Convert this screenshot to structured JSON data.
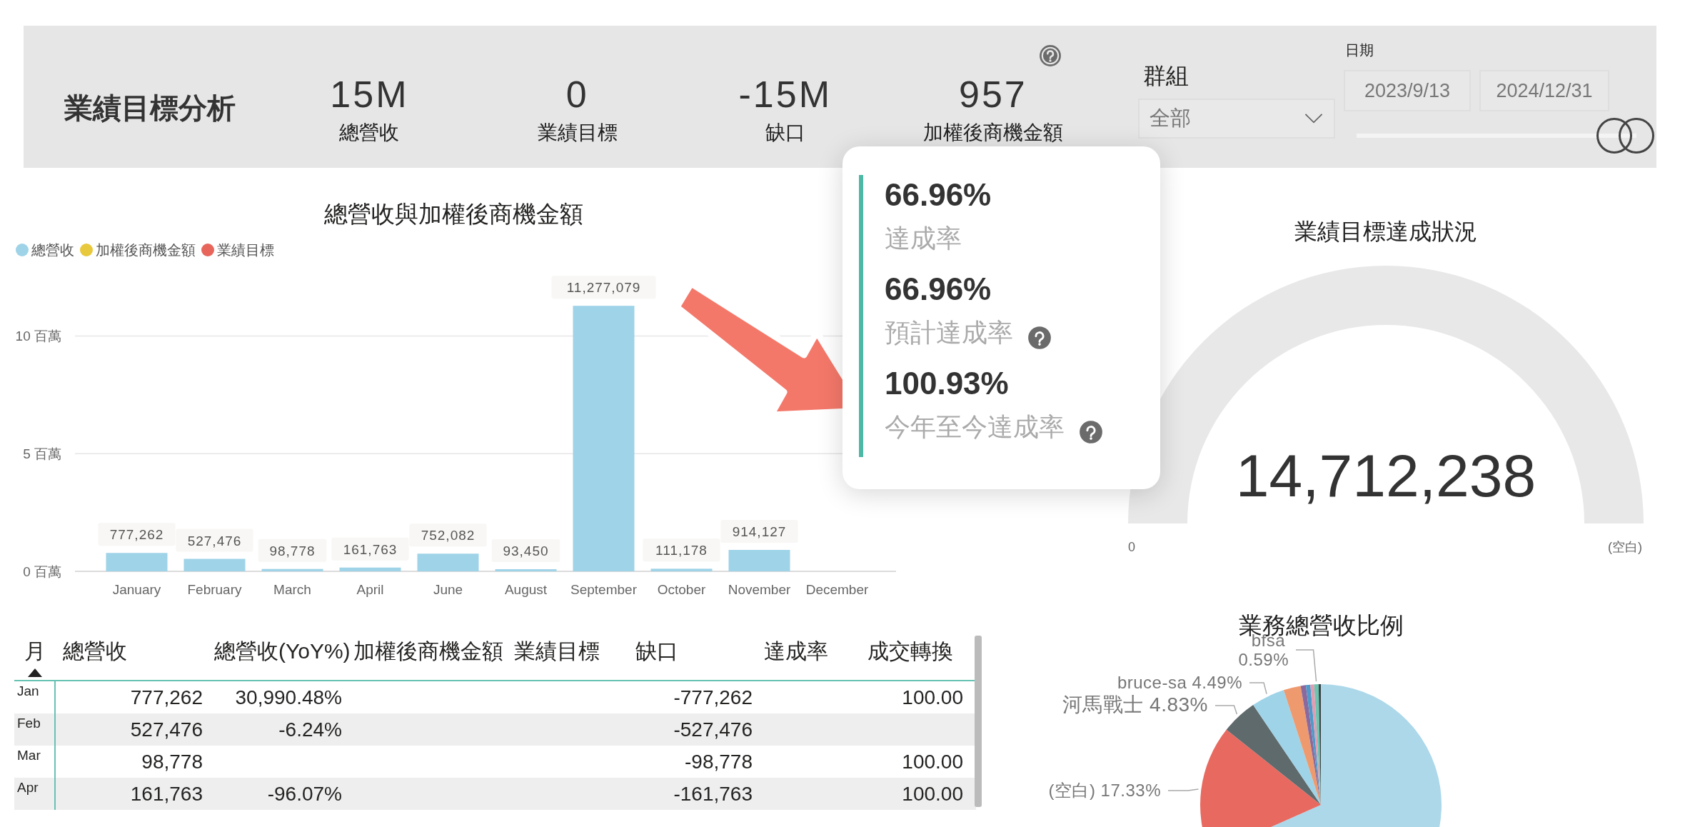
{
  "header": {
    "title": "業績目標分析",
    "kpis": [
      {
        "value": "15M",
        "label": "總營收",
        "help": false
      },
      {
        "value": "0",
        "label": "業績目標",
        "help": false
      },
      {
        "value": "-15M",
        "label": "缺口",
        "help": false
      },
      {
        "value": "957",
        "label": "加權後商機金額",
        "help": true
      }
    ],
    "group_filter": {
      "label": "群組",
      "value": "全部"
    },
    "date_filter": {
      "label": "日期",
      "start": "2023/9/13",
      "end": "2024/12/31",
      "slider": {
        "thumbs": [
          {
            "level": 0.92
          },
          {
            "level": 1
          }
        ]
      }
    }
  },
  "revenue_chart": {
    "chart_data": {
      "type": "bar",
      "title": "總營收與加權後商機金額",
      "categories": [
        "January",
        "February",
        "March",
        "April",
        "June",
        "August",
        "September",
        "October",
        "November",
        "December"
      ],
      "series": [
        {
          "name": "總營收",
          "color": "#9ed3e8",
          "values": [
            0.78,
            0.53,
            0.1,
            0.16,
            0.75,
            0.09,
            11.28,
            0.11,
            0.91,
            null
          ]
        },
        {
          "name": "加權後商機金額",
          "color": "#e8c83c",
          "values": [
            null,
            null,
            null,
            null,
            null,
            null,
            null,
            null,
            null,
            null
          ]
        },
        {
          "name": "業績目標",
          "color": "#e8655b",
          "values": [
            null,
            null,
            null,
            null,
            null,
            null,
            null,
            null,
            null,
            null
          ]
        }
      ],
      "ylim": [
        0,
        12.5
      ],
      "yticks": [
        {
          "value": 0,
          "label": "0 百萬"
        },
        {
          "value": 5,
          "label": "5 百萬"
        },
        {
          "value": 10,
          "label": "10 百萬"
        }
      ],
      "value_labels": [
        "777,262",
        "527,476",
        "98,778",
        "161,763",
        "752,082",
        "93,450",
        "11,277,079",
        "111,178",
        "914,127",
        null
      ]
    }
  },
  "tooltip": {
    "items": [
      {
        "value": "66.96%",
        "label": "達成率",
        "help": false
      },
      {
        "value": "66.96%",
        "label": "預計達成率",
        "help": true
      },
      {
        "value": "100.93%",
        "label": "今年至今達成率",
        "help": true
      }
    ]
  },
  "gauge": {
    "title": "業績目標達成狀況",
    "value": "14,712,238",
    "min_label": "0",
    "max_label": "(空白)"
  },
  "table": {
    "columns": [
      {
        "label": "月",
        "sorted": true
      },
      {
        "label": "總營收",
        "sorted": false
      },
      {
        "label": "總營收(YoY%)",
        "sorted": false
      },
      {
        "label": "加權後商機金額",
        "sorted": false
      },
      {
        "label": "業績目標",
        "sorted": false
      },
      {
        "label": "缺口",
        "sorted": false
      },
      {
        "label": "達成率",
        "sorted": false
      },
      {
        "label": "成交轉換",
        "sorted": false
      }
    ],
    "rows": [
      {
        "cells": [
          "Jan",
          "777,262",
          "30,990.48%",
          "",
          "",
          "-777,262",
          "",
          "100.00"
        ]
      },
      {
        "cells": [
          "Feb",
          "527,476",
          "-6.24%",
          "",
          "",
          "-527,476",
          "",
          ""
        ]
      },
      {
        "cells": [
          "Mar",
          "98,778",
          "",
          "",
          "",
          "-98,778",
          "",
          "100.00"
        ]
      },
      {
        "cells": [
          "Apr",
          "161,763",
          "-96.07%",
          "",
          "",
          "-161,763",
          "",
          "100.00"
        ]
      }
    ]
  },
  "share_chart": {
    "chart_data": {
      "type": "pie",
      "title": "業務總營收比例",
      "categories": [
        null,
        "(空白)",
        "河馬戰士",
        "bruce-sa",
        null,
        null,
        null,
        null,
        "bfsa",
        null
      ],
      "values": [
        68.36,
        17.33,
        4.83,
        4.49,
        2.3,
        0.7,
        0.6,
        0.5,
        0.59,
        0.3
      ],
      "value_labels": [
        null,
        "17.33%",
        "4.83%",
        "4.49%",
        null,
        null,
        null,
        null,
        "0.59%",
        null
      ]
    }
  }
}
